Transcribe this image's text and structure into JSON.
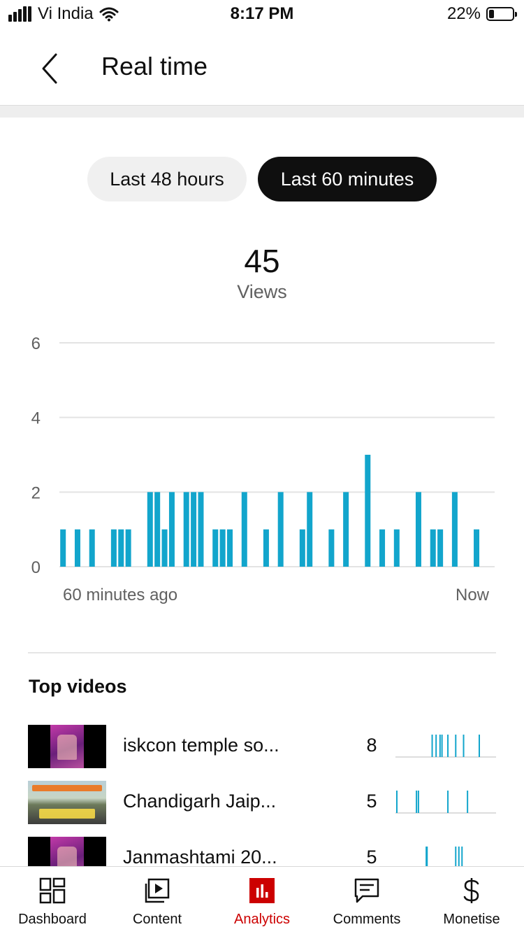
{
  "status_bar": {
    "carrier": "Vi India",
    "time": "8:17 PM",
    "battery": "22%"
  },
  "header": {
    "title": "Real time"
  },
  "toggle": {
    "option_48h": "Last 48 hours",
    "option_60m": "Last 60 minutes",
    "selected": "Last 60 minutes"
  },
  "summary": {
    "value": "45",
    "label": "Views"
  },
  "chart_data": {
    "type": "bar",
    "xlabel_start": "60 minutes ago",
    "xlabel_end": "Now",
    "ylim": [
      0,
      6
    ],
    "yticks": [
      0,
      2,
      4,
      6
    ],
    "grid": true,
    "color": "#12a5cc",
    "x": [
      1,
      3,
      5,
      8,
      9,
      10,
      13,
      14,
      15,
      16,
      18,
      19,
      20,
      22,
      23,
      24,
      26,
      29,
      31,
      34,
      35,
      38,
      40,
      43,
      45,
      47,
      50,
      52,
      53,
      55,
      58
    ],
    "values": [
      1,
      1,
      1,
      1,
      1,
      1,
      2,
      2,
      1,
      2,
      2,
      2,
      2,
      1,
      1,
      1,
      2,
      1,
      2,
      1,
      2,
      1,
      2,
      3,
      1,
      1,
      2,
      1,
      1,
      2,
      1
    ]
  },
  "top_videos": {
    "title": "Top videos",
    "items": [
      {
        "title": "iskcon temple so...",
        "views": "8",
        "spark": [
          9,
          10,
          11,
          11.5,
          13,
          15,
          17,
          21
        ]
      },
      {
        "title": "Chandigarh Jaip...",
        "views": "5",
        "spark": [
          0,
          5,
          5.5,
          13,
          18
        ]
      },
      {
        "title": "Janmashtami 20...",
        "views": "5",
        "spark": [
          7.5,
          7.7,
          15,
          15.8,
          16.6
        ]
      }
    ]
  },
  "nav": {
    "items": [
      {
        "label": "Dashboard",
        "icon": "dashboard-icon"
      },
      {
        "label": "Content",
        "icon": "content-icon"
      },
      {
        "label": "Analytics",
        "icon": "analytics-icon",
        "active": true
      },
      {
        "label": "Comments",
        "icon": "comments-icon"
      },
      {
        "label": "Monetise",
        "icon": "monetise-icon"
      }
    ],
    "active_color": "#cc0000"
  }
}
